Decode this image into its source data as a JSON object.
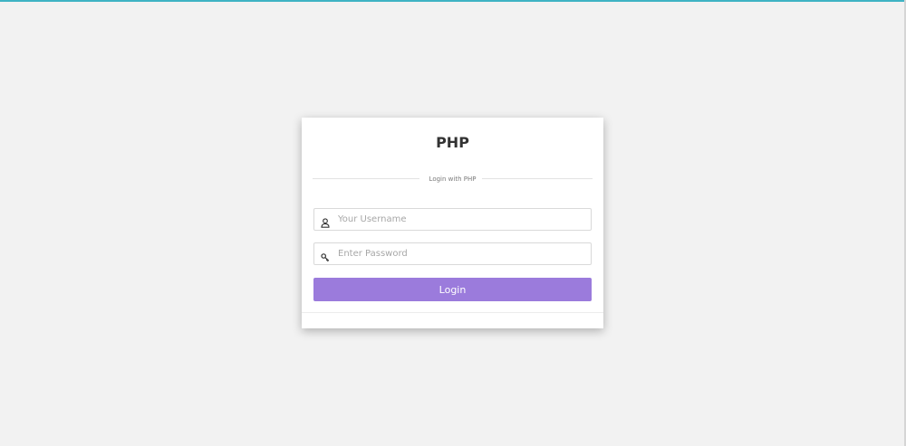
{
  "colors": {
    "top_accent": "#3fb3c4",
    "login_button": "#9b7bdc",
    "background": "#f2f2f2"
  },
  "card": {
    "title": "PHP",
    "divider_text": "Login with PHP"
  },
  "form": {
    "username": {
      "placeholder": "Your Username",
      "value": "",
      "icon": "user-icon"
    },
    "password": {
      "placeholder": "Enter Password",
      "value": "",
      "icon": "key-icon"
    },
    "login_label": "Login"
  }
}
